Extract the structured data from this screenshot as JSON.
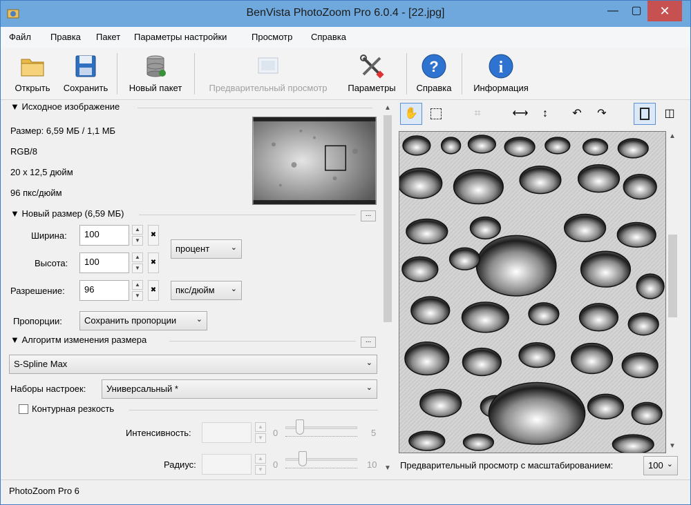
{
  "window": {
    "title": "BenVista PhotoZoom Pro 6.0.4 - [22.jpg]",
    "minimize": "—",
    "maximize": "▢",
    "close": "✕"
  },
  "menu": [
    "Файл",
    "Правка",
    "Пакет",
    "Параметры настройки",
    "Просмотр",
    "Справка"
  ],
  "toolbar": {
    "open": "Открыть",
    "save": "Сохранить",
    "new_batch": "Новый пакет",
    "preview": "Предварительный просмотр",
    "settings": "Параметры",
    "help": "Справка",
    "info": "Информация"
  },
  "source": {
    "header": "Исходное изображение",
    "size": "Размер: 6,59 МБ / 1,1 МБ",
    "mode": "RGB/8",
    "dimensions": "20 x 12,5 дюйм",
    "dpi": "96 пкс/дюйм"
  },
  "new_size": {
    "header": "Новый размер (6,59 МБ)",
    "more": "...",
    "width_label": "Ширина:",
    "width_value": "100",
    "height_label": "Высота:",
    "height_value": "100",
    "unit": "процент",
    "resolution_label": "Разрешение:",
    "resolution_value": "96",
    "resolution_unit": "пкс/дюйм",
    "proportions_label": "Пропорции:",
    "proportions_value": "Сохранить пропорции"
  },
  "algorithm": {
    "header": "Алгоритм изменения размера",
    "more": "...",
    "method": "S-Spline Max",
    "presets_label": "Наборы настроек:",
    "presets_value": "Универсальный *"
  },
  "sharpness": {
    "label": "Контурная резкость",
    "intensity_label": "Интенсивность:",
    "intensity_min": "0",
    "intensity_max": "5",
    "radius_label": "Радиус:",
    "radius_min": "0",
    "radius_max": "10"
  },
  "preview": {
    "zoom_label": "Предварительный просмотр с масштабированием:",
    "zoom_value": "100"
  },
  "status": "PhotoZoom Pro 6"
}
